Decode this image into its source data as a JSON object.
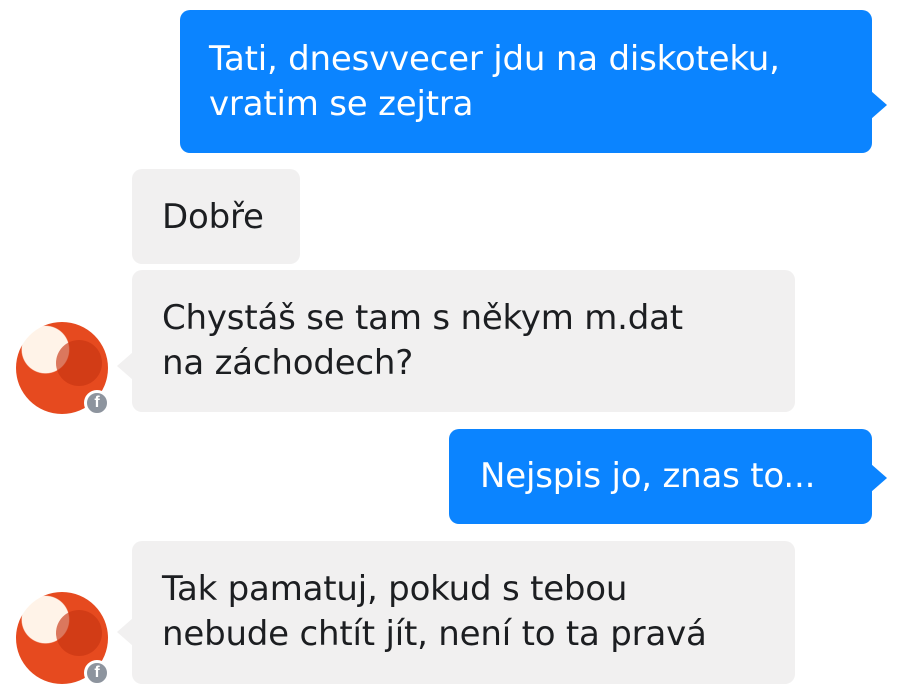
{
  "conversation": {
    "messages": [
      {
        "direction": "outgoing",
        "lines": [
          "Tati, dnesvvecer jdu na diskoteku,",
          "vratim se zejtra"
        ]
      },
      {
        "direction": "incoming",
        "lines": [
          "Dobře"
        ]
      },
      {
        "direction": "incoming",
        "lines": [
          "Chystáš se tam s někym m.dat",
          "na záchodech?"
        ],
        "show_avatar": true
      },
      {
        "direction": "outgoing",
        "lines": [
          "Nejspis jo, znas to..."
        ]
      },
      {
        "direction": "incoming",
        "lines": [
          "Tak pamatuj, pokud s tebou",
          "nebude chtít jít, není to ta pravá"
        ],
        "show_avatar": true
      }
    ],
    "avatar_badge_icon": "facebook-icon",
    "avatar_badge_glyph": "f"
  },
  "colors": {
    "outgoing_bubble": "#0b84ff",
    "incoming_bubble": "#f1f0f0",
    "outgoing_text": "#ffffff",
    "incoming_text": "#1c1e21",
    "badge": "#8d949e",
    "avatar": "#e64a1f"
  }
}
